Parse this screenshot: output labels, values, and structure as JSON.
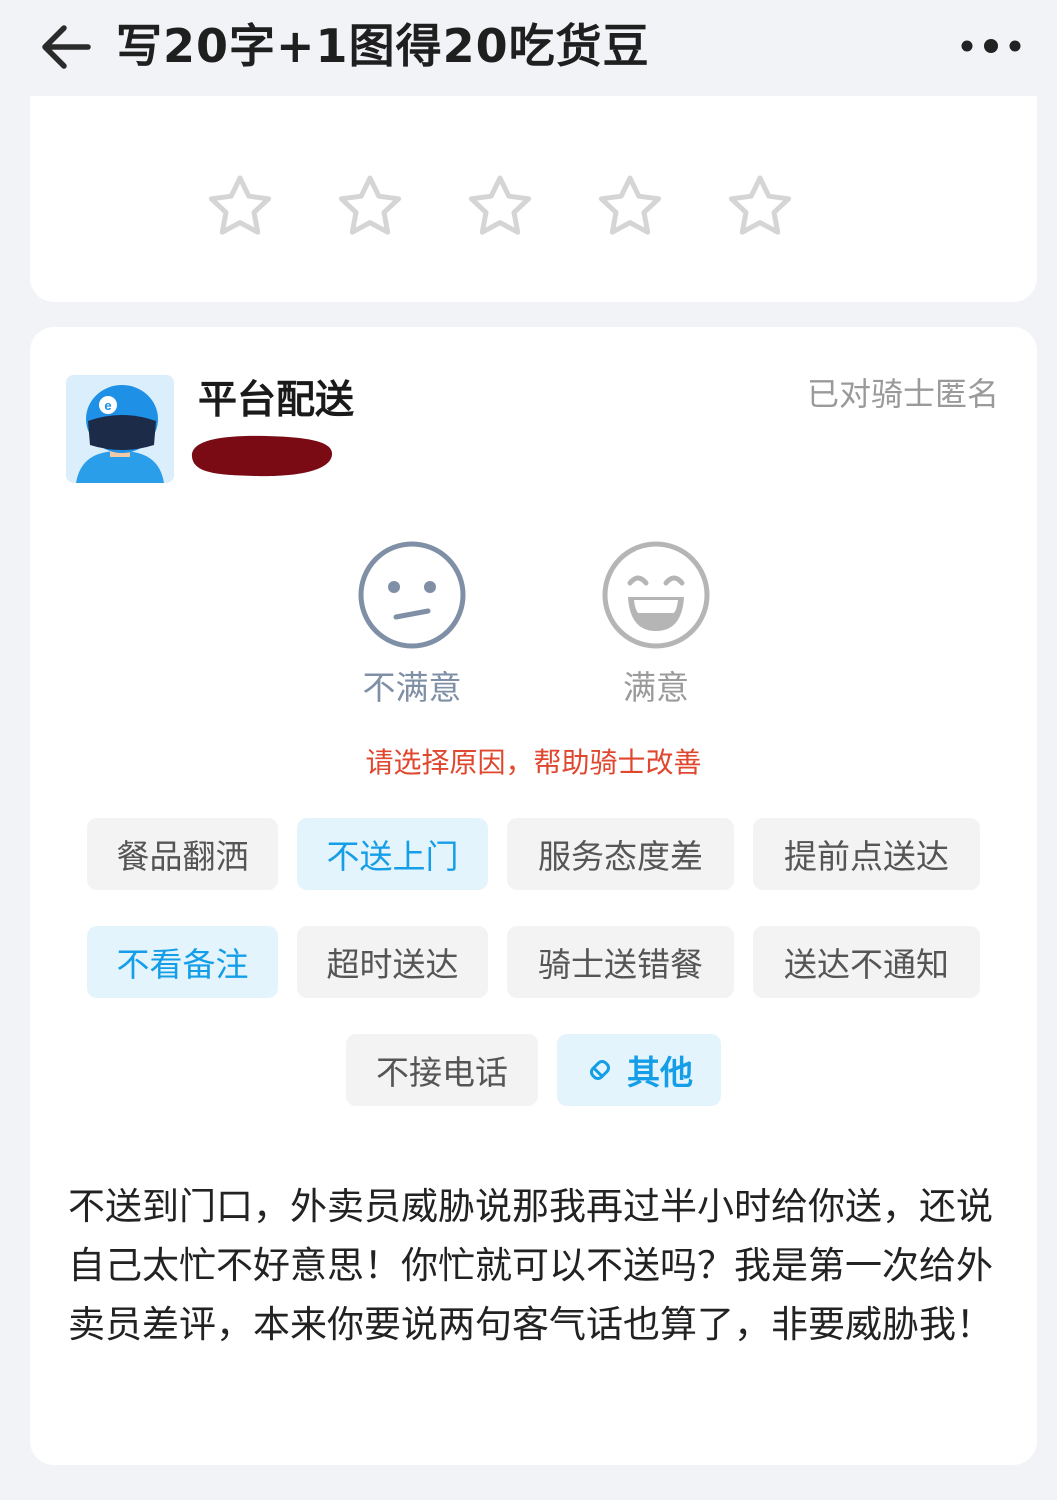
{
  "header": {
    "title": "写20字+1图得20吃货豆"
  },
  "rating": {
    "star_count": 5,
    "selected": 0
  },
  "rider": {
    "name": "平台配送",
    "anonymous_label": "已对骑士匿名"
  },
  "satisfaction": {
    "unsatisfied_label": "不满意",
    "satisfied_label": "满意",
    "selected": "unsatisfied"
  },
  "hint": "请选择原因，帮助骑士改善",
  "tags": [
    {
      "label": "餐品翻洒",
      "selected": false
    },
    {
      "label": "不送上门",
      "selected": true
    },
    {
      "label": "服务态度差",
      "selected": false
    },
    {
      "label": "提前点送达",
      "selected": false
    },
    {
      "label": "不看备注",
      "selected": true
    },
    {
      "label": "超时送达",
      "selected": false
    },
    {
      "label": "骑士送错餐",
      "selected": false
    },
    {
      "label": "送达不通知",
      "selected": false
    },
    {
      "label": "不接电话",
      "selected": false
    },
    {
      "label": "其他",
      "selected": true
    }
  ],
  "comment": "不送到门口，外卖员威胁说那我再过半小时给你送，还说自己太忙不好意思！你忙就可以不送吗？我是第一次给外卖员差评，本来你要说两句客气话也算了，非要威胁我！",
  "colors": {
    "accent": "#159ee8",
    "hint": "#e0472f",
    "background": "#f1f3f6"
  }
}
